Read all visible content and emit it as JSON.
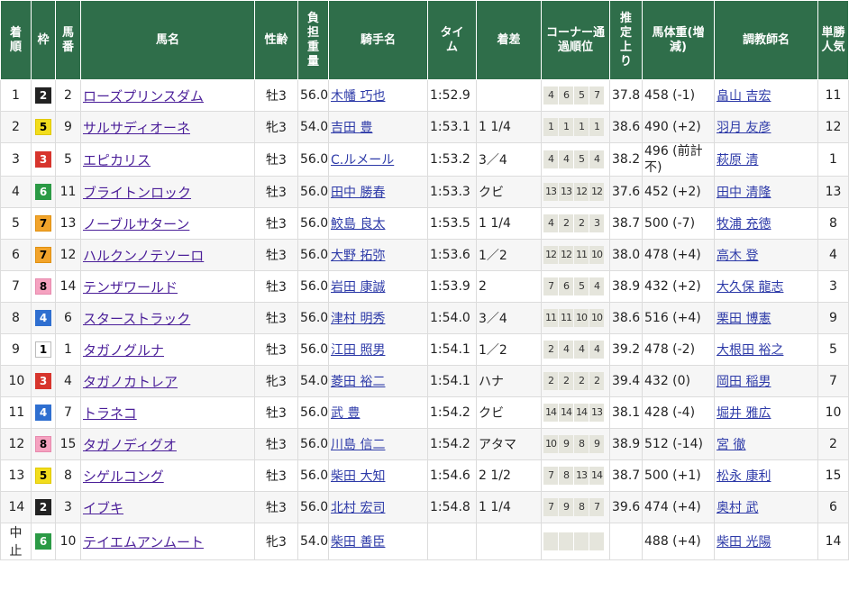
{
  "headers": [
    "着順",
    "枠",
    "馬番",
    "馬名",
    "性齢",
    "負担重量",
    "騎手名",
    "タイム",
    "着差",
    "コーナー通過順位",
    "推定上り",
    "馬体重(増減)",
    "調教師名",
    "単勝人気"
  ],
  "rows": [
    {
      "rank": "1",
      "waku": "2",
      "waku_color": "w2",
      "num": "2",
      "horse": "ローズプリンスダム",
      "sex_age": "牡3",
      "weight": "56.0",
      "jockey": "木幡 巧也",
      "time": "1:52.9",
      "margin": "",
      "corners": [
        "4",
        "6",
        "5",
        "7"
      ],
      "last3f": "37.8",
      "body_weight": "458 (-1)",
      "trainer": "畠山 吉宏",
      "popularity": "11"
    },
    {
      "rank": "2",
      "waku": "5",
      "waku_color": "w5",
      "num": "9",
      "horse": "サルサディオーネ",
      "sex_age": "牝3",
      "weight": "54.0",
      "jockey": "吉田 豊",
      "time": "1:53.1",
      "margin": "1 1/4",
      "corners": [
        "1",
        "1",
        "1",
        "1"
      ],
      "last3f": "38.6",
      "body_weight": "490 (+2)",
      "trainer": "羽月 友彦",
      "popularity": "12"
    },
    {
      "rank": "3",
      "waku": "3",
      "waku_color": "w3",
      "num": "5",
      "horse": "エピカリス",
      "sex_age": "牡3",
      "weight": "56.0",
      "jockey": "C.ルメール",
      "time": "1:53.2",
      "margin": "3／4",
      "corners": [
        "4",
        "4",
        "5",
        "4"
      ],
      "last3f": "38.2",
      "body_weight": "496 (前計不)",
      "trainer": "萩原 清",
      "popularity": "1"
    },
    {
      "rank": "4",
      "waku": "6",
      "waku_color": "w6",
      "num": "11",
      "horse": "ブライトンロック",
      "sex_age": "牡3",
      "weight": "56.0",
      "jockey": "田中 勝春",
      "time": "1:53.3",
      "margin": "クビ",
      "corners": [
        "13",
        "13",
        "12",
        "12"
      ],
      "last3f": "37.6",
      "body_weight": "452 (+2)",
      "trainer": "田中 清隆",
      "popularity": "13"
    },
    {
      "rank": "5",
      "waku": "7",
      "waku_color": "w7",
      "num": "13",
      "horse": "ノーブルサターン",
      "sex_age": "牡3",
      "weight": "56.0",
      "jockey": "鮫島 良太",
      "time": "1:53.5",
      "margin": "1 1/4",
      "corners": [
        "4",
        "2",
        "2",
        "3"
      ],
      "last3f": "38.7",
      "body_weight": "500 (-7)",
      "trainer": "牧浦 充徳",
      "popularity": "8"
    },
    {
      "rank": "6",
      "waku": "7",
      "waku_color": "w7",
      "num": "12",
      "horse": "ハルクンノテソーロ",
      "sex_age": "牡3",
      "weight": "56.0",
      "jockey": "大野 拓弥",
      "time": "1:53.6",
      "margin": "1／2",
      "corners": [
        "12",
        "12",
        "11",
        "10"
      ],
      "last3f": "38.0",
      "body_weight": "478 (+4)",
      "trainer": "高木 登",
      "popularity": "4"
    },
    {
      "rank": "7",
      "waku": "8",
      "waku_color": "w8",
      "num": "14",
      "horse": "テンザワールド",
      "sex_age": "牡3",
      "weight": "56.0",
      "jockey": "岩田 康誠",
      "time": "1:53.9",
      "margin": "2",
      "corners": [
        "7",
        "6",
        "5",
        "4"
      ],
      "last3f": "38.9",
      "body_weight": "432 (+2)",
      "trainer": "大久保 龍志",
      "popularity": "3"
    },
    {
      "rank": "8",
      "waku": "4",
      "waku_color": "w4",
      "num": "6",
      "horse": "スターストラック",
      "sex_age": "牡3",
      "weight": "56.0",
      "jockey": "津村 明秀",
      "time": "1:54.0",
      "margin": "3／4",
      "corners": [
        "11",
        "11",
        "10",
        "10"
      ],
      "last3f": "38.6",
      "body_weight": "516 (+4)",
      "trainer": "栗田 博憲",
      "popularity": "9"
    },
    {
      "rank": "9",
      "waku": "1",
      "waku_color": "w1",
      "num": "1",
      "horse": "タガノグルナ",
      "sex_age": "牡3",
      "weight": "56.0",
      "jockey": "江田 照男",
      "time": "1:54.1",
      "margin": "1／2",
      "corners": [
        "2",
        "4",
        "4",
        "4"
      ],
      "last3f": "39.2",
      "body_weight": "478 (-2)",
      "trainer": "大根田 裕之",
      "popularity": "5"
    },
    {
      "rank": "10",
      "waku": "3",
      "waku_color": "w3",
      "num": "4",
      "horse": "タガノカトレア",
      "sex_age": "牝3",
      "weight": "54.0",
      "jockey": "菱田 裕二",
      "time": "1:54.1",
      "margin": "ハナ",
      "corners": [
        "2",
        "2",
        "2",
        "2"
      ],
      "last3f": "39.4",
      "body_weight": "432 (0)",
      "trainer": "岡田 稲男",
      "popularity": "7"
    },
    {
      "rank": "11",
      "waku": "4",
      "waku_color": "w4",
      "num": "7",
      "horse": "トラネコ",
      "sex_age": "牡3",
      "weight": "56.0",
      "jockey": "武 豊",
      "time": "1:54.2",
      "margin": "クビ",
      "corners": [
        "14",
        "14",
        "14",
        "13"
      ],
      "last3f": "38.1",
      "body_weight": "428 (-4)",
      "trainer": "堀井 雅広",
      "popularity": "10"
    },
    {
      "rank": "12",
      "waku": "8",
      "waku_color": "w8",
      "num": "15",
      "horse": "タガノディグオ",
      "sex_age": "牡3",
      "weight": "56.0",
      "jockey": "川島 信二",
      "time": "1:54.2",
      "margin": "アタマ",
      "corners": [
        "10",
        "9",
        "8",
        "9"
      ],
      "last3f": "38.9",
      "body_weight": "512 (-14)",
      "trainer": "宮 徹",
      "popularity": "2"
    },
    {
      "rank": "13",
      "waku": "5",
      "waku_color": "w5",
      "num": "8",
      "horse": "シゲルコング",
      "sex_age": "牡3",
      "weight": "56.0",
      "jockey": "柴田 大知",
      "time": "1:54.6",
      "margin": "2 1/2",
      "corners": [
        "7",
        "8",
        "13",
        "14"
      ],
      "last3f": "38.7",
      "body_weight": "500 (+1)",
      "trainer": "松永 康利",
      "popularity": "15"
    },
    {
      "rank": "14",
      "waku": "2",
      "waku_color": "w2",
      "num": "3",
      "horse": "イブキ",
      "sex_age": "牡3",
      "weight": "56.0",
      "jockey": "北村 宏司",
      "time": "1:54.8",
      "margin": "1 1/4",
      "corners": [
        "7",
        "9",
        "8",
        "7"
      ],
      "last3f": "39.6",
      "body_weight": "474 (+4)",
      "trainer": "奥村 武",
      "popularity": "6"
    },
    {
      "rank": "中止",
      "waku": "6",
      "waku_color": "w6",
      "num": "10",
      "horse": "テイエムアンムート",
      "sex_age": "牝3",
      "weight": "54.0",
      "jockey": "柴田 善臣",
      "time": "",
      "margin": "",
      "corners": [
        "",
        "",
        "",
        ""
      ],
      "last3f": "",
      "body_weight": "488 (+4)",
      "trainer": "柴田 光陽",
      "popularity": "14"
    }
  ],
  "colors": {
    "header_bg": "#2f6e4a",
    "horse_link": "#4b1f99",
    "link": "#2d3aa8"
  }
}
